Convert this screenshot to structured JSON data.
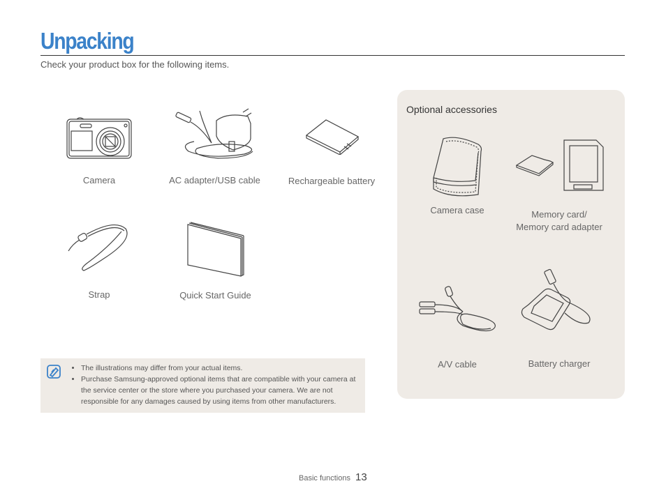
{
  "header": {
    "title": "Unpacking",
    "subtitle": "Check your product box for the following items."
  },
  "colors": {
    "accent": "#3b82c9",
    "panel_bg": "#efebe6"
  },
  "box_items": [
    {
      "label": "Camera",
      "icon": "camera-icon"
    },
    {
      "label": "AC adapter/USB cable",
      "icon": "ac-adapter-icon"
    },
    {
      "label": "Rechargeable battery",
      "icon": "battery-icon"
    },
    {
      "label": "Strap",
      "icon": "strap-icon"
    },
    {
      "label": "Quick Start Guide",
      "icon": "guide-icon"
    }
  ],
  "optional": {
    "title": "Optional accessories",
    "items": [
      {
        "label": "Camera case",
        "icon": "camera-case-icon"
      },
      {
        "label_line1": "Memory card/",
        "label_line2": "Memory card adapter",
        "icon": "memory-card-icon"
      },
      {
        "label": "A/V cable",
        "icon": "av-cable-icon"
      },
      {
        "label": "Battery charger",
        "icon": "battery-charger-icon"
      }
    ]
  },
  "note": {
    "icon": "note-icon",
    "bullets": [
      "The illustrations may differ from your actual items.",
      "Purchase Samsung-approved optional items that are compatible with your camera at the service center or the store where you purchased your camera. We are not responsible for any damages caused by using items from other manufacturers."
    ]
  },
  "footer": {
    "section": "Basic functions",
    "page": "13"
  }
}
